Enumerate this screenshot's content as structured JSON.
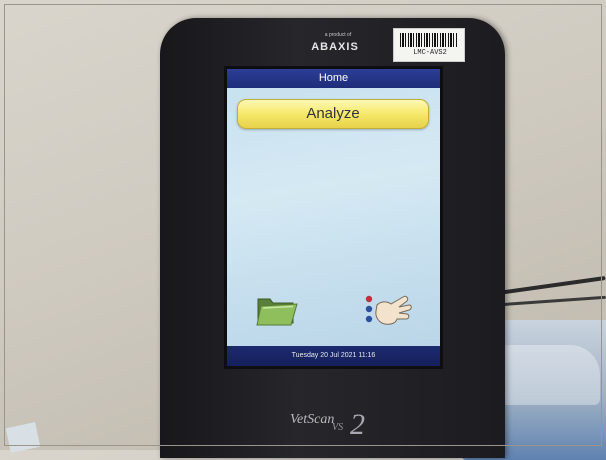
{
  "device": {
    "product_of": "a product of",
    "brand": "ABAXIS",
    "sticker_id": "LMC-AVS2",
    "logo_text": "VetScan",
    "logo_vs": "VS",
    "logo_num": "2"
  },
  "screen": {
    "title": "Home",
    "analyze_label": "Analyze",
    "status": "Tuesday 20 Jul 2021 11:16"
  },
  "icons": [
    "folder-icon",
    "menu-hand-icon"
  ],
  "colors": {
    "title_bar": "#1e2d7a",
    "analyze_button": "#f6e86a",
    "screen_bg": "#c6e0ef"
  }
}
